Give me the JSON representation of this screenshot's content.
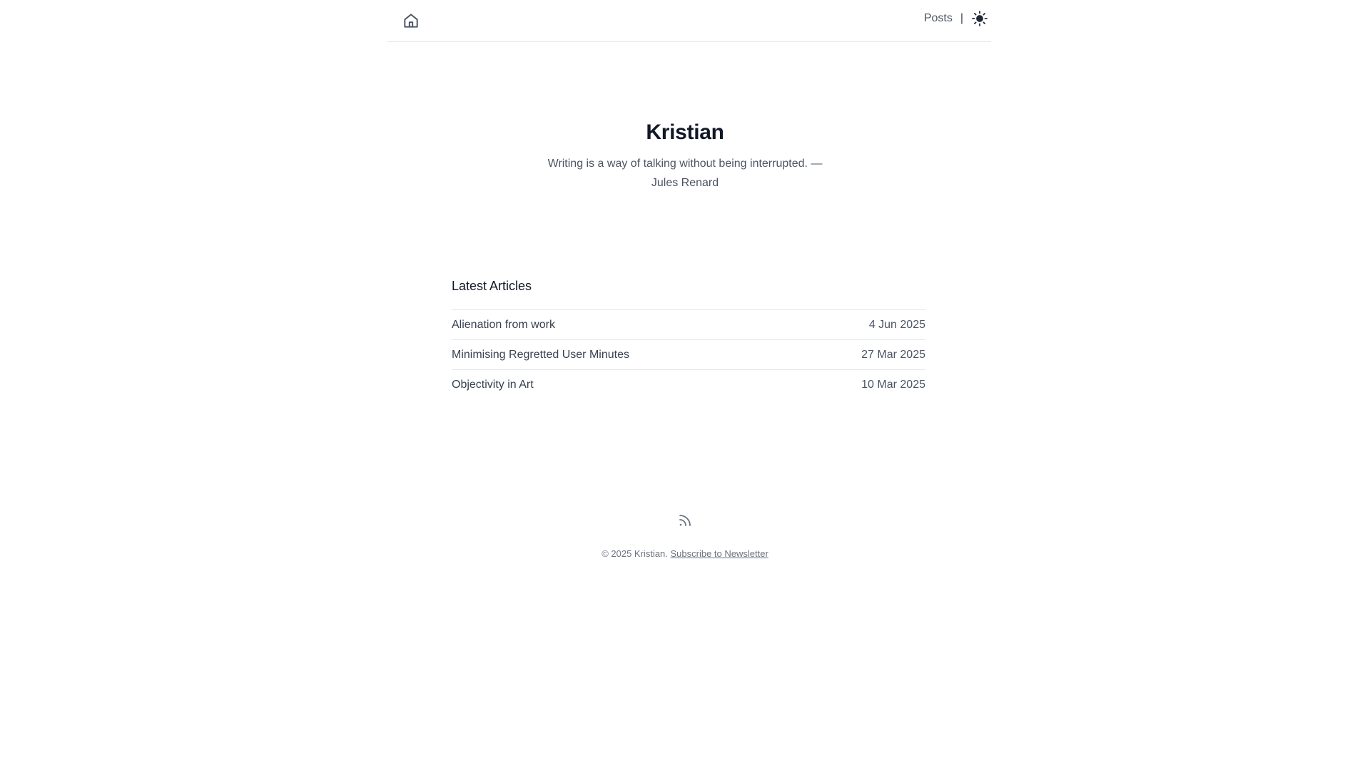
{
  "header": {
    "home_icon": "home-icon",
    "nav": {
      "posts_label": "Posts",
      "separator": "|",
      "theme_icon": "sun-icon"
    }
  },
  "hero": {
    "title": "Kristian",
    "quote": "Writing is a way of talking without being interrupted. — Jules Renard"
  },
  "articles": {
    "heading": "Latest Articles",
    "items": [
      {
        "title": "Alienation from work",
        "date": "4 Jun 2025"
      },
      {
        "title": "Minimising Regretted User Minutes",
        "date": "27 Mar 2025"
      },
      {
        "title": "Objectivity in Art",
        "date": "10 Mar 2025"
      }
    ]
  },
  "footer": {
    "rss_icon": "rss-icon",
    "copyright": "© 2025 Kristian.",
    "newsletter_label": "Subscribe to Newsletter"
  },
  "colors": {
    "text_primary": "#111827",
    "text_body": "#374151",
    "text_muted": "#6b7280",
    "divider": "#e5e7eb"
  }
}
